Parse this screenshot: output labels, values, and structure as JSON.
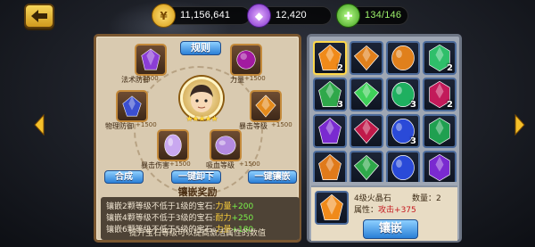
{
  "header": {
    "back_icon": "back-arrow-icon",
    "resources": [
      {
        "icon": "gold-coin-icon",
        "value": "11,156,641"
      },
      {
        "icon": "diamond-gem-icon",
        "value": "12,420"
      },
      {
        "icon": "stamina-icon",
        "value": "134/146"
      }
    ]
  },
  "inlay_panel": {
    "rules_label": "规则",
    "slots": [
      {
        "label": "法术防御",
        "value": "+1500",
        "color": "#8b3dd6"
      },
      {
        "label": "力量",
        "value": "+1500",
        "color": "#a21aa0"
      },
      {
        "label": "物理防御",
        "value": "+1500",
        "color": "#3b4fd0"
      },
      {
        "label": "暴击等级",
        "value": "+1500",
        "color": "#e38a1c"
      },
      {
        "label": "暴击伤害",
        "value": "+1500",
        "color": "#c9a8f0"
      },
      {
        "label": "吸血等级",
        "value": "+1500",
        "color": "#b48ae0"
      }
    ],
    "stars": "★★★★★",
    "buttons": {
      "compose": "合成",
      "unload_all": "一键卸下",
      "inlay_all": "一键镶嵌"
    },
    "reward_title": "镶嵌奖励",
    "rewards": [
      {
        "text": "镶嵌2颗等级不低于1级的宝石:",
        "stat": "力量",
        "value": "+200"
      },
      {
        "text": "镶嵌4颗等级不低于3级的宝石:",
        "stat": "耐力",
        "value": "+250"
      },
      {
        "text": "镶嵌6颗等级不低于5级的宝石:",
        "stat": "力量",
        "value": "+180"
      }
    ],
    "reward_footer": "提升宝石等级可以提高激活属性的数值"
  },
  "gem_grid": {
    "cells": [
      {
        "color": "#f08a1a",
        "count": "2",
        "selected": true
      },
      {
        "color": "#e0801c",
        "count": ""
      },
      {
        "color": "#e0801c",
        "count": ""
      },
      {
        "color": "#2fbf6a",
        "count": "2"
      },
      {
        "color": "#2fa84a",
        "count": "3"
      },
      {
        "color": "#3fd05a",
        "count": ""
      },
      {
        "color": "#1fb060",
        "count": "3"
      },
      {
        "color": "#c21a5a",
        "count": "2"
      },
      {
        "color": "#7a2ad0",
        "count": ""
      },
      {
        "color": "#c01a4a",
        "count": ""
      },
      {
        "color": "#2a4ad8",
        "count": "3"
      },
      {
        "color": "#1fa050",
        "count": ""
      },
      {
        "color": "#e07a1a",
        "count": ""
      },
      {
        "color": "#2fa84a",
        "count": ""
      },
      {
        "color": "#2a4ad8",
        "count": ""
      },
      {
        "color": "#7a2ad0",
        "count": ""
      }
    ]
  },
  "detail": {
    "name": "4级火晶石",
    "quantity": "数量：2",
    "attr_label": "属性：",
    "attr_stat": "攻击",
    "attr_value": "+375",
    "inlay_label": "镶嵌"
  }
}
